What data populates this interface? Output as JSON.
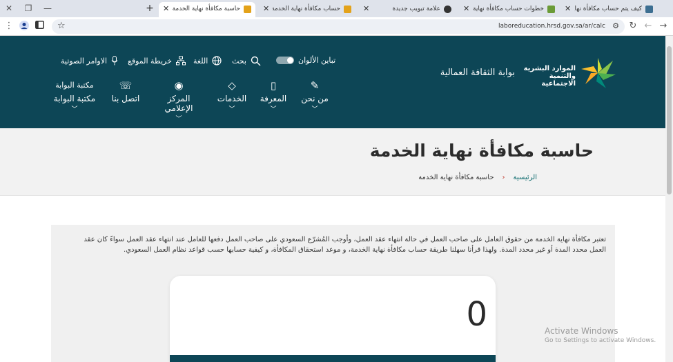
{
  "browser": {
    "tabs": [
      {
        "title": "كيف يتم حساب مكافأة نهاية الخدمة",
        "active": false,
        "favicon_color": "#3c6e91"
      },
      {
        "title": "خطوات حساب مكافأة نهاية الخدمة",
        "active": false,
        "favicon_color": "#6b9b37"
      },
      {
        "title": "علامة تبويب جديدة",
        "active": false,
        "favicon_color": "#333333"
      },
      {
        "title": "حساب مكافأة نهاية الخدمة | وزارة",
        "active": false,
        "favicon_color": "#e3a21a"
      },
      {
        "title": "حاسبة مكافأة نهاية الخدمة | بوابة",
        "active": true,
        "favicon_color": "#e3a21a"
      }
    ],
    "url": "laboreducation.hrsd.gov.sa/ar/calc"
  },
  "header": {
    "logo_text": "الموارد البشرية والتنمية الاجتماعية",
    "portal_title": "بوابة الثقافة العمالية",
    "utility": {
      "contrast": "تباين الألوان",
      "search": "بحث",
      "language": "اللغة",
      "sitemap": "خريطة الموقع",
      "voice": "الاوامر الصوتية"
    },
    "nav": [
      {
        "label": "من نحن",
        "icon": "document-icon"
      },
      {
        "label": "المعرفة",
        "icon": "book-icon"
      },
      {
        "label": "الخدمات",
        "icon": "handshake-icon"
      },
      {
        "label": "المركز الإعلامي",
        "icon": "camera-icon"
      },
      {
        "label": "اتصل بنا",
        "icon": "phone-icon"
      },
      {
        "label": "مكتبة البوابة",
        "icon": "broken-image-icon",
        "img_alt": "مكتبة البوابة"
      }
    ]
  },
  "hero": {
    "title": "حاسبة مكافأة نهاية الخدمة",
    "breadcrumb_home": "الرئيسية",
    "breadcrumb_current": "حاسبة مكافأة نهاية الخدمة"
  },
  "content": {
    "intro": "تعتبر مكافأة نهاية الخدمة من حقوق العامل على صاحب العمل في حالة انتهاء عقد العمل، وأوجب المُشرّع السعودي على صاحب العمل دفعها للعامل عند انتهاء عقد العمل سواءً كان عقد العمل محدد المدة أو غير محدد المدة. ولهذا قرأنا سهلنا طريقة حساب مكافأة نهاية الخدمة، و موعد استحقاق المكافأة، و كيفية حسابها حسب قواعد نظام العمل السعودي.",
    "result": "0"
  },
  "watermark": {
    "title": "Activate Windows",
    "subtitle": "Go to Settings to activate Windows."
  },
  "colors": {
    "header_bg": "#0d4656",
    "accent_green": "#0d6b6e"
  }
}
